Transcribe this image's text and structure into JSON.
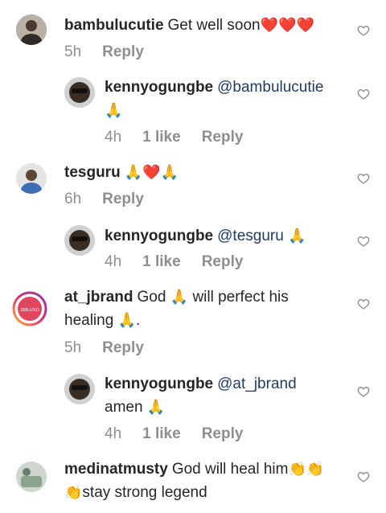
{
  "comments": [
    {
      "user": "bambulucutie",
      "text": "Get well soon",
      "emoji": "❤️❤️❤️",
      "time": "5h",
      "reply": "Reply"
    },
    {
      "user": "kennyogungbe",
      "mention": "@bambulucutie",
      "emoji": "🙏",
      "time": "4h",
      "likes": "1 like",
      "reply": "Reply"
    },
    {
      "user": "tesguru",
      "emoji": "🙏❤️🙏",
      "time": "6h",
      "reply": "Reply"
    },
    {
      "user": "kennyogungbe",
      "mention": "@tesguru",
      "emoji": "🙏",
      "time": "4h",
      "likes": "1 like",
      "reply": "Reply"
    },
    {
      "user": "at_jbrand",
      "text_a": "God",
      "emoji_a": "🙏",
      "text_b": "will perfect his healing",
      "emoji_b": "🙏",
      "text_c": ".",
      "time": "5h",
      "reply": "Reply",
      "avatar_label": "JBRAND"
    },
    {
      "user": "kennyogungbe",
      "mention": "@at_jbrand",
      "text": "amen",
      "emoji": "🙏",
      "time": "4h",
      "likes": "1 like",
      "reply": "Reply"
    },
    {
      "user": "medinatmusty",
      "text_a": "God will heal him",
      "emoji": "👏👏👏",
      "text_b": "stay strong legend"
    }
  ],
  "icons": {
    "like": "heart-outline-icon"
  },
  "colors": {
    "meta": "#8e8e8e",
    "mention": "#1e3a5f",
    "text": "#262626"
  }
}
